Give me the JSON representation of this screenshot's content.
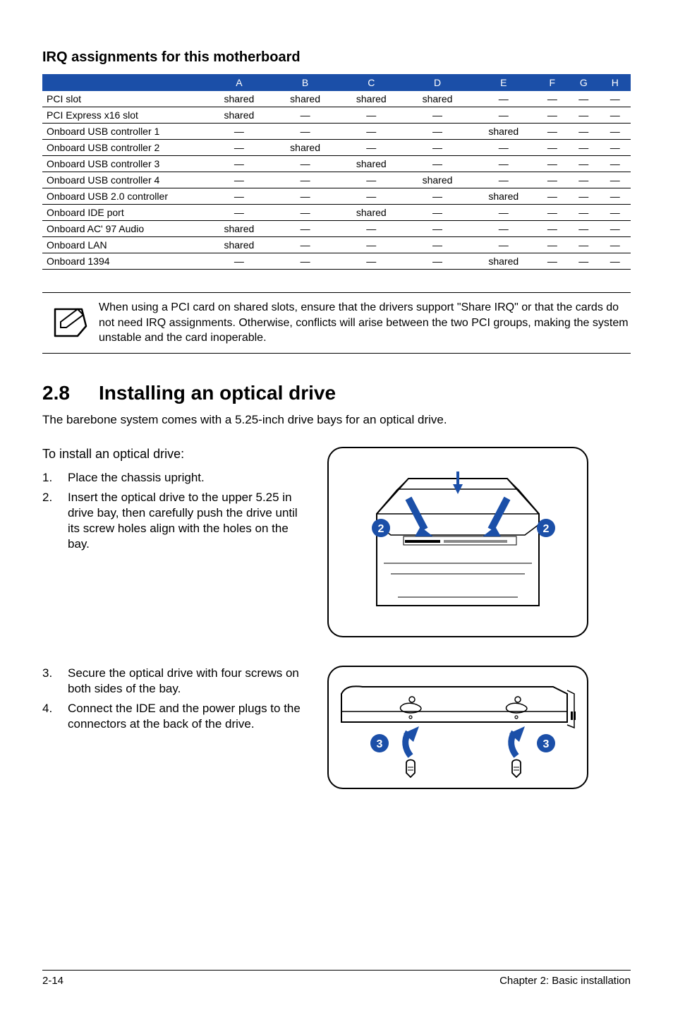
{
  "subheading": "IRQ assignments for this motherboard",
  "table": {
    "headers": [
      "",
      "A",
      "B",
      "C",
      "D",
      "E",
      "F",
      "G",
      "H"
    ],
    "rows": [
      {
        "label": "PCI slot",
        "cells": [
          "shared",
          "shared",
          "shared",
          "shared",
          "—",
          "—",
          "—",
          "—"
        ]
      },
      {
        "label": "PCI Express x16 slot",
        "cells": [
          "shared",
          "—",
          "—",
          "—",
          "—",
          "—",
          "—",
          "—"
        ]
      },
      {
        "label": "Onboard USB controller 1",
        "cells": [
          "—",
          "—",
          "—",
          "—",
          "shared",
          "—",
          "—",
          "—"
        ]
      },
      {
        "label": "Onboard USB controller 2",
        "cells": [
          "—",
          "shared",
          "—",
          "—",
          "—",
          "—",
          "—",
          "—"
        ]
      },
      {
        "label": "Onboard USB controller 3",
        "cells": [
          "—",
          "—",
          "shared",
          "—",
          "—",
          "—",
          "—",
          "—"
        ]
      },
      {
        "label": "Onboard USB controller 4",
        "cells": [
          "—",
          "—",
          "—",
          "shared",
          "—",
          "—",
          "—",
          "—"
        ]
      },
      {
        "label": "Onboard USB 2.0 controller",
        "cells": [
          "—",
          "—",
          "—",
          "—",
          "shared",
          "—",
          "—",
          "—"
        ]
      },
      {
        "label": "Onboard IDE port",
        "cells": [
          "—",
          "—",
          "shared",
          "—",
          "—",
          "—",
          "—",
          "—"
        ]
      },
      {
        "label": "Onboard AC' 97 Audio",
        "cells": [
          "shared",
          "—",
          "—",
          "—",
          "—",
          "—",
          "—",
          "—"
        ]
      },
      {
        "label": "Onboard LAN",
        "cells": [
          "shared",
          "—",
          "—",
          "—",
          "—",
          "—",
          "—",
          "—"
        ]
      },
      {
        "label": "Onboard 1394",
        "cells": [
          "—",
          "—",
          "—",
          "—",
          "shared",
          "—",
          "—",
          "—"
        ]
      }
    ]
  },
  "note": "When using a PCI card on shared slots, ensure that the drivers support \"Share IRQ\" or that the cards do not need IRQ assignments. Otherwise, conflicts will arise between the two PCI groups, making the system unstable and the card inoperable.",
  "section": {
    "num": "2.8",
    "title": "Installing an optical drive"
  },
  "intro": "The barebone system comes with a 5.25-inch drive bays for an optical drive.",
  "subtitle": "To install an optical drive:",
  "steps1": [
    {
      "n": "1.",
      "t": "Place the chassis upright."
    },
    {
      "n": "2.",
      "t": "Insert the optical drive to the upper 5.25 in drive bay, then carefully push the drive until its screw holes align with the holes on the bay."
    }
  ],
  "steps2": [
    {
      "n": "3.",
      "t": "Secure the optical drive with four screws on both sides of the bay."
    },
    {
      "n": "4.",
      "t": "Connect the IDE and the power plugs to the connectors at the back of the drive."
    }
  ],
  "callouts1": {
    "left": "2",
    "right": "2"
  },
  "callouts2": {
    "left": "3",
    "right": "3"
  },
  "footer": {
    "left": "2-14",
    "right": "Chapter 2: Basic installation"
  }
}
